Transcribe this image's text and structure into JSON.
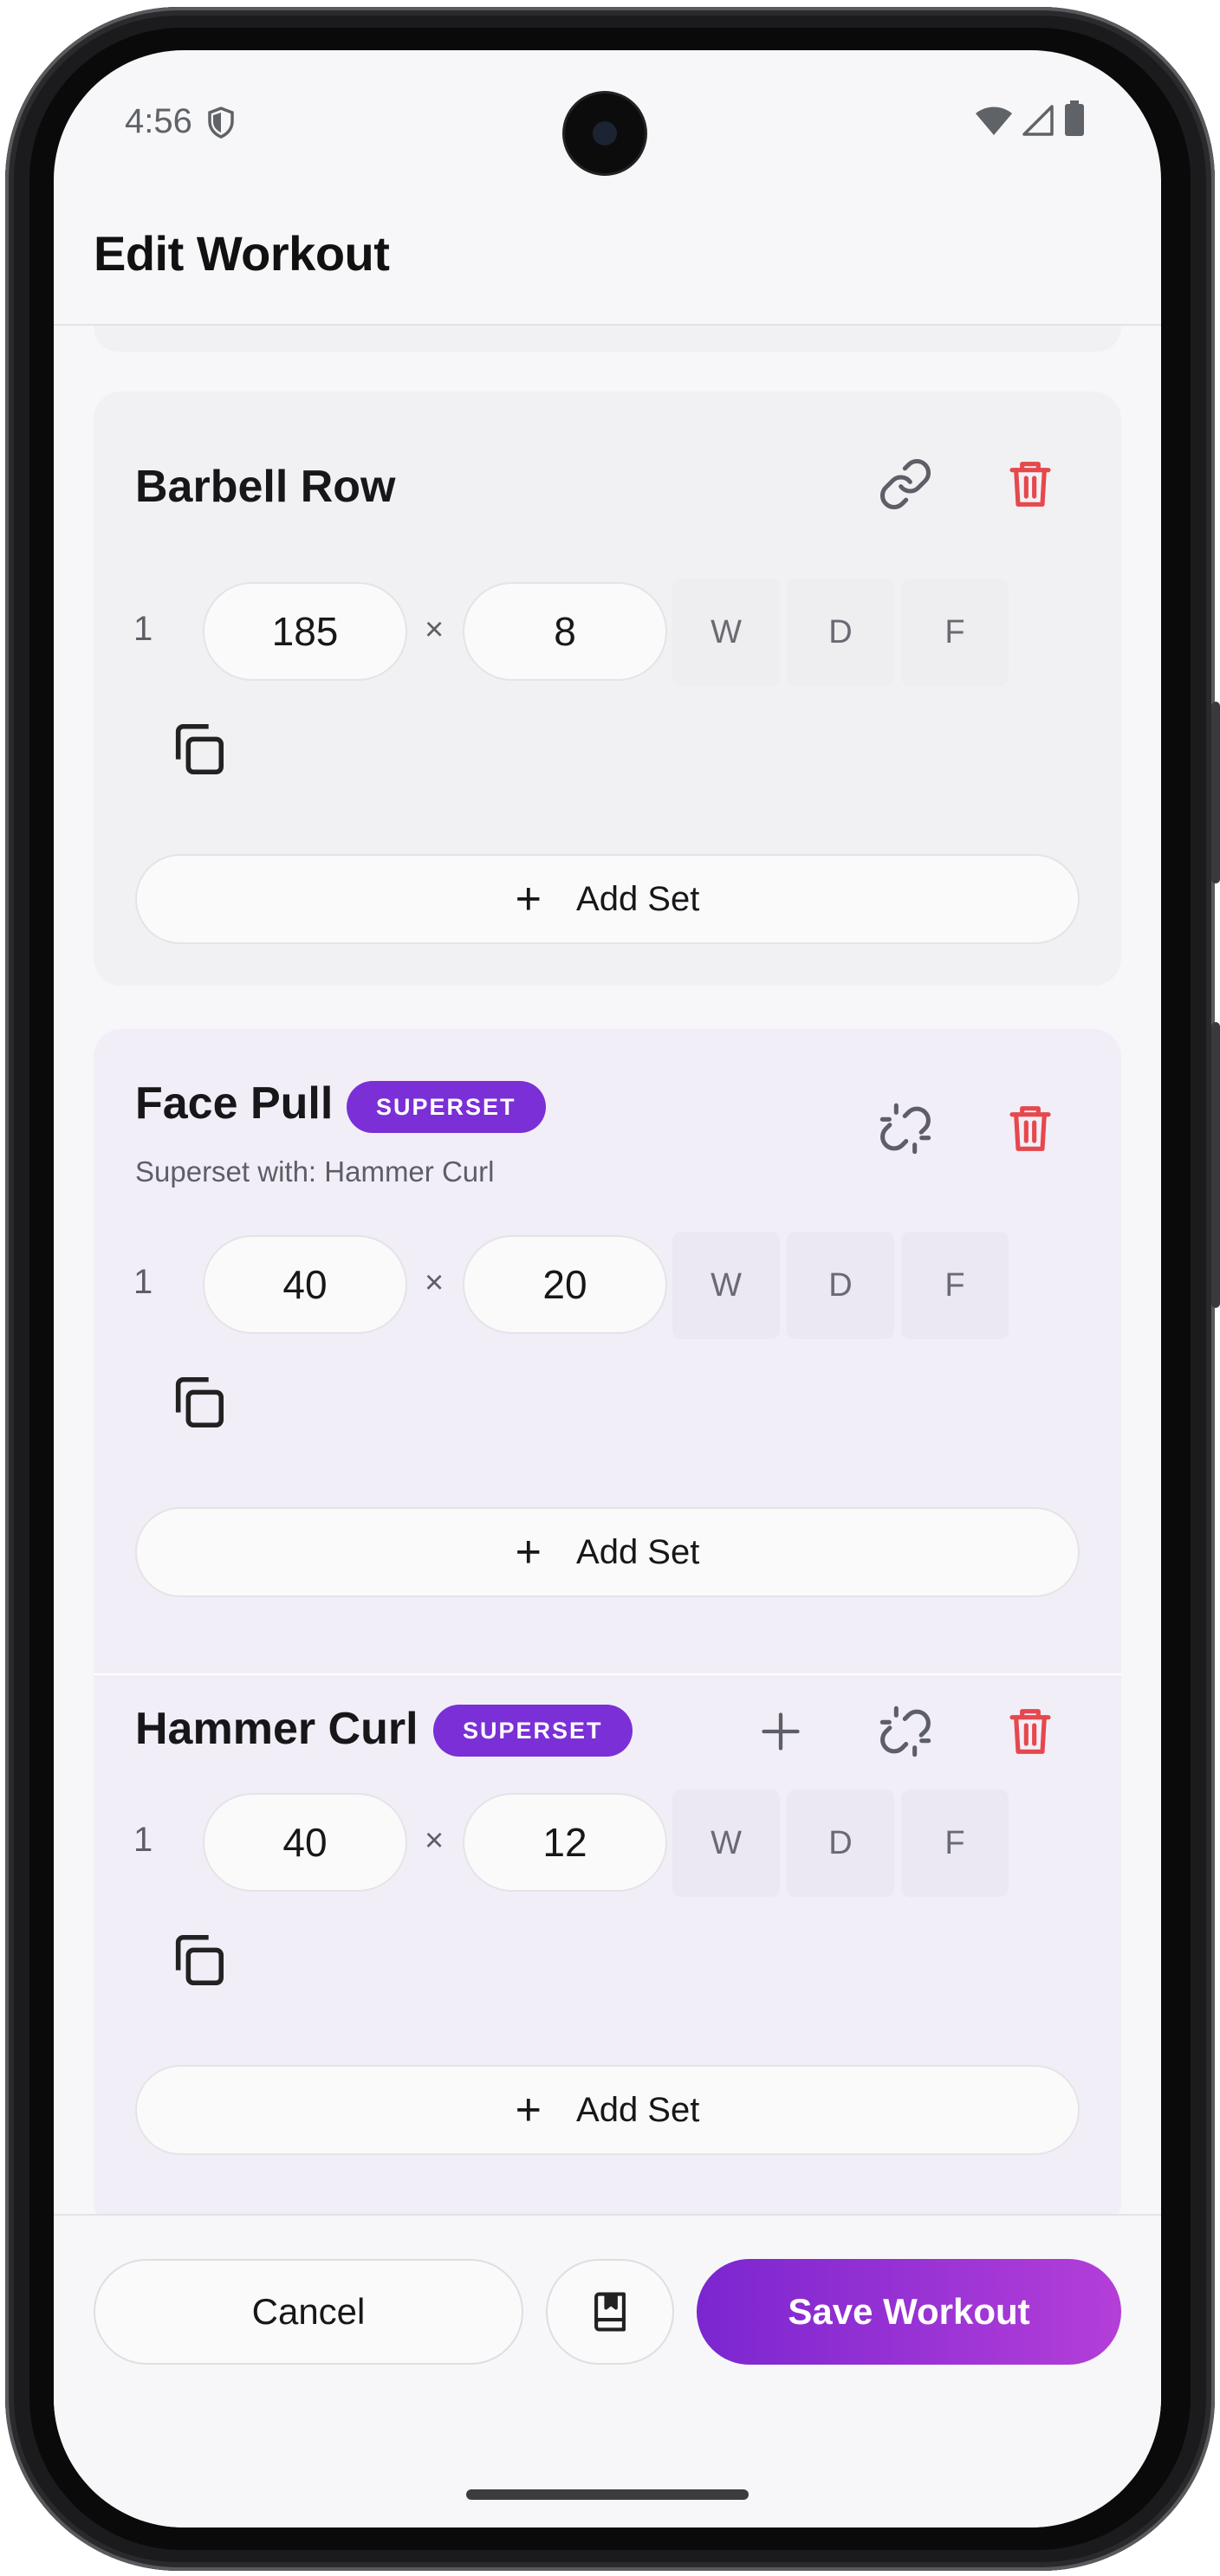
{
  "status_bar": {
    "time": "4:56"
  },
  "header": {
    "title": "Edit Workout"
  },
  "exercises": [
    {
      "name": "Barbell Row",
      "sets": [
        {
          "number": "1",
          "weight": "185",
          "reps": "8",
          "times": "×",
          "tags": [
            "W",
            "D",
            "F"
          ]
        }
      ],
      "add_set_label": "Add Set"
    },
    {
      "name": "Face Pull",
      "badge": "SUPERSET",
      "superset_with": "Superset with: Hammer Curl",
      "sets": [
        {
          "number": "1",
          "weight": "40",
          "reps": "20",
          "times": "×",
          "tags": [
            "W",
            "D",
            "F"
          ]
        }
      ],
      "add_set_label": "Add Set"
    },
    {
      "name": "Hammer Curl",
      "badge": "SUPERSET",
      "sets": [
        {
          "number": "1",
          "weight": "40",
          "reps": "12",
          "times": "×",
          "tags": [
            "W",
            "D",
            "F"
          ]
        }
      ],
      "add_set_label": "Add Set"
    }
  ],
  "footer": {
    "cancel_label": "Cancel",
    "save_label": "Save Workout"
  },
  "colors": {
    "accent": "#7b2fd6",
    "delete": "#e5484d",
    "superset_bg": "#f2eef7"
  }
}
